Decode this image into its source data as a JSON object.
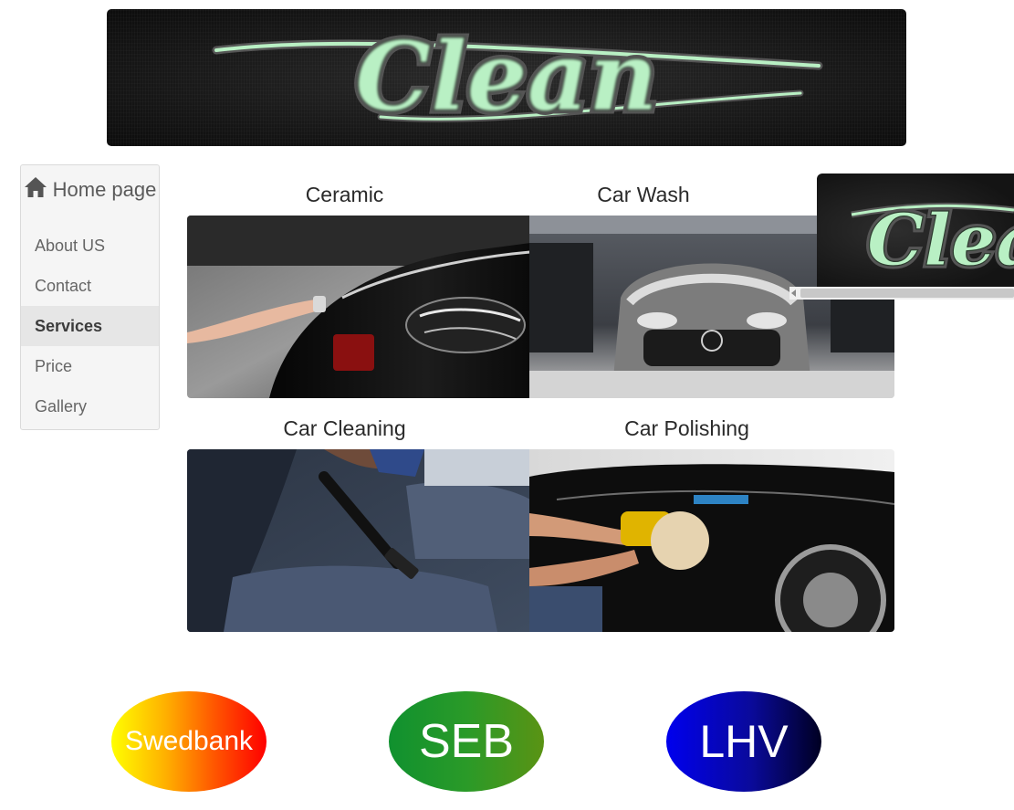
{
  "banner": {
    "logo_text": "Clean"
  },
  "nav": {
    "home_label": "Home page",
    "items": [
      {
        "label": "About US",
        "active": false
      },
      {
        "label": "Contact",
        "active": false
      },
      {
        "label": "Services",
        "active": true
      },
      {
        "label": "Price",
        "active": false
      },
      {
        "label": "Gallery",
        "active": false
      }
    ]
  },
  "services": [
    {
      "caption": "Ceramic",
      "image": "ceramic coating on black car headlight"
    },
    {
      "caption": "Car Wash",
      "image": "foam-covered mercedes in wash bay"
    },
    {
      "caption": "Car Cleaning",
      "image": "vacuum cleaning car seat"
    },
    {
      "caption": "Car Polishing",
      "image": "orbital polisher on black car door"
    }
  ],
  "floating_thumb": {
    "logo_text": "Clean"
  },
  "banks": [
    {
      "label": "Swedbank"
    },
    {
      "label": "SEB"
    },
    {
      "label": "LHV"
    }
  ],
  "colors": {
    "logo_green": "#b9f0c4",
    "nav_bg": "#f5f5f5",
    "nav_active_bg": "#e6e6e6",
    "swedbank_from": "#ffff00",
    "swedbank_to": "#ff0000",
    "seb_from": "#10912f",
    "seb_to": "#5a9314",
    "lhv_from": "#0000ee",
    "lhv_to": "#000022"
  }
}
